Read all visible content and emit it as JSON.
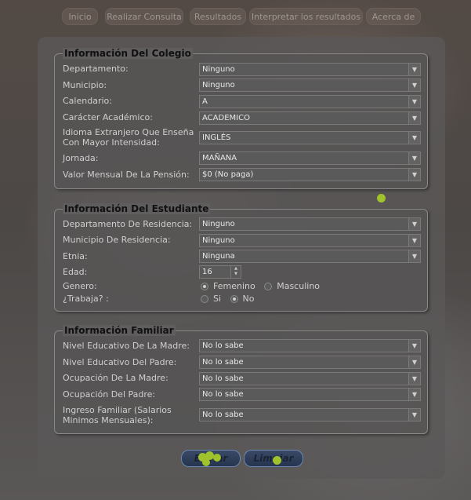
{
  "nav": {
    "items": [
      "Inicio",
      "Realizar Consulta",
      "Resultados",
      "Interpretar los resultados",
      "Acerca de"
    ]
  },
  "colegio": {
    "legend": "Información Del Colegio",
    "fields": [
      {
        "label": "Departamento:",
        "value": "Ninguno"
      },
      {
        "label": "Municipio:",
        "value": "Ninguno"
      },
      {
        "label": "Calendario:",
        "value": "A"
      },
      {
        "label": "Carácter Académico:",
        "value": "ACADEMICO"
      },
      {
        "label": "Idioma Extranjero Que Enseña Con Mayor Intensidad:",
        "value": "INGLÉS"
      },
      {
        "label": "Jornada:",
        "value": "MAÑANA"
      },
      {
        "label": "Valor Mensual De La Pensión:",
        "value": "$0 (No paga)"
      }
    ]
  },
  "estudiante": {
    "legend": "Información Del Estudiante",
    "fields": [
      {
        "label": "Departamento De Residencia:",
        "value": "Ninguno"
      },
      {
        "label": "Municipio De Residencia:",
        "value": "Ninguno"
      },
      {
        "label": "Etnia:",
        "value": "Ninguna"
      }
    ],
    "edad_label": "Edad:",
    "edad_value": "16",
    "genero_label": "Genero:",
    "genero_options": [
      "Femenino",
      "Masculino"
    ],
    "genero_selected": "Femenino",
    "trabaja_label": "¿Trabaja? :",
    "trabaja_options": [
      "Si",
      "No"
    ],
    "trabaja_selected": "No"
  },
  "familiar": {
    "legend": "Información Familiar",
    "fields": [
      {
        "label": "Nivel Educativo De La Madre:",
        "value": "No lo sabe"
      },
      {
        "label": "Nivel Educativo Del Padre:",
        "value": "No lo sabe"
      },
      {
        "label": "Ocupación De La Madre:",
        "value": "No lo sabe"
      },
      {
        "label": "Ocupación Del Padre:",
        "value": "No lo sabe"
      },
      {
        "label": "Ingreso Familiar (Salarios Minimos Mensuales):",
        "value": "No lo sabe"
      }
    ]
  },
  "actions": {
    "submit_label": "Enviar",
    "clear_label": "Limpiar"
  },
  "colors": {
    "accent_dot": "#9fc22d",
    "button_blue": "#2e3d5a"
  },
  "icons": {
    "dropdown": "chevron-down-icon",
    "spinner": "spinner-arrows-icon"
  }
}
